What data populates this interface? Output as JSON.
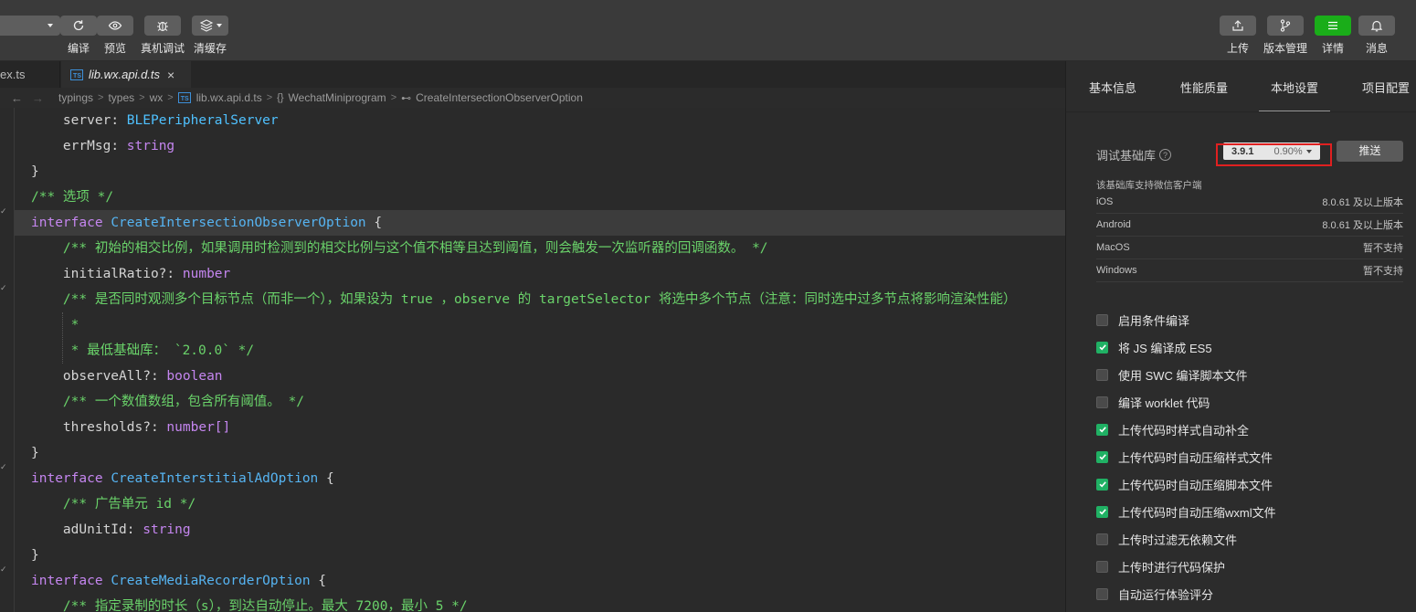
{
  "toolbar": {
    "left_buttons": [
      {
        "label": "编译",
        "icon": "refresh-icon"
      },
      {
        "label": "预览",
        "icon": "eye-icon"
      },
      {
        "label": "真机调试",
        "icon": "bug-icon"
      },
      {
        "label": "清缓存",
        "icon": "layers-icon"
      }
    ],
    "right_buttons": [
      {
        "label": "上传",
        "icon": "upload-icon"
      },
      {
        "label": "版本管理",
        "icon": "branch-icon"
      },
      {
        "label": "详情",
        "icon": "menu-icon"
      },
      {
        "label": "消息",
        "icon": "bell-icon"
      }
    ],
    "accent_color": "#1aad19"
  },
  "tabs": {
    "inactive": "ex.ts",
    "active": "lib.wx.api.d.ts",
    "close_glyph": "×",
    "ts_badge": "TS"
  },
  "breadcrumb": {
    "back": "←",
    "forward": "→",
    "items": [
      "typings",
      "types",
      "wx",
      "lib.wx.api.d.ts",
      "WechatMiniprogram",
      "CreateIntersectionObserverOption"
    ],
    "sep": ">",
    "ns_icon": "{}",
    "prop_icon": "⊷"
  },
  "code": {
    "lines": [
      "    server: BLEPeripheralServer",
      "    errMsg: string",
      "}",
      "/** 选项 */",
      "interface CreateIntersectionObserverOption {",
      "    /** 初始的相交比例，如果调用时检测到的相交比例与这个值不相等且达到阈值，则会触发一次监听器的回调函数。 */",
      "    initialRatio?: number",
      "    /** 是否同时观测多个目标节点（而非一个），如果设为 true ，observe 的 targetSelector 将选中多个节点（注意：同时选中过多节点将影响渲染性能）",
      "     *",
      "     * 最低基础库： `2.0.0` */",
      "    observeAll?: boolean",
      "    /** 一个数值数组，包含所有阈值。 */",
      "    thresholds?: number[]",
      "}",
      "interface CreateInterstitialAdOption {",
      "    /** 广告单元 id */",
      "    adUnitId: string",
      "}",
      "interface CreateMediaRecorderOption {",
      "    /** 指定录制的时长（s），到达自动停止。最大 7200，最小 5 */"
    ],
    "highlighted_line": 4
  },
  "panel": {
    "tabs": [
      "基本信息",
      "性能质量",
      "本地设置",
      "项目配置"
    ],
    "active_tab": "本地设置",
    "lib": {
      "label": "调试基础库",
      "help": "?",
      "version": "3.9.1",
      "percent": "0.90%",
      "push_label": "推送"
    },
    "support": {
      "title": "该基础库支持微信客户端",
      "rows": [
        {
          "os": "iOS",
          "value": "8.0.61 及以上版本"
        },
        {
          "os": "Android",
          "value": "8.0.61 及以上版本"
        },
        {
          "os": "MacOS",
          "value": "暂不支持"
        },
        {
          "os": "Windows",
          "value": "暂不支持"
        }
      ]
    },
    "options": [
      {
        "label": "启用条件编译",
        "checked": false
      },
      {
        "label": "将 JS 编译成 ES5",
        "checked": true
      },
      {
        "label": "使用 SWC 编译脚本文件",
        "checked": false
      },
      {
        "label": "编译 worklet 代码",
        "checked": false
      },
      {
        "label": "上传代码时样式自动补全",
        "checked": true
      },
      {
        "label": "上传代码时自动压缩样式文件",
        "checked": true
      },
      {
        "label": "上传代码时自动压缩脚本文件",
        "checked": true
      },
      {
        "label": "上传代码时自动压缩wxml文件",
        "checked": true
      },
      {
        "label": "上传时过滤无依赖文件",
        "checked": false
      },
      {
        "label": "上传时进行代码保护",
        "checked": false
      },
      {
        "label": "自动运行体验评分",
        "checked": false
      }
    ],
    "check_color": "#20b164",
    "highlight_color": "#e02020"
  }
}
